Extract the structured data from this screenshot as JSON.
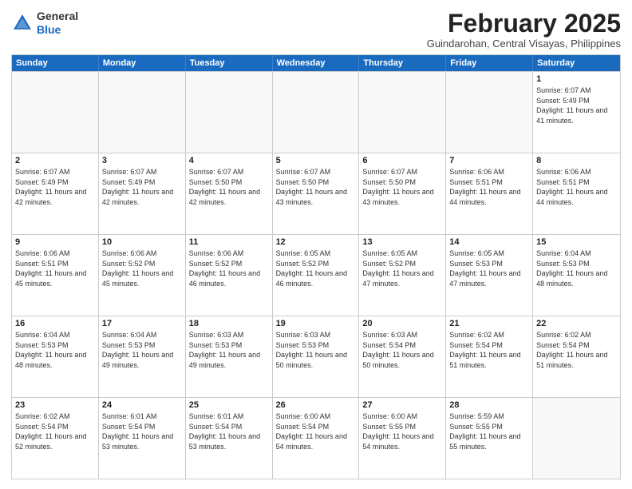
{
  "header": {
    "logo_general": "General",
    "logo_blue": "Blue",
    "month_year": "February 2025",
    "location": "Guindarohan, Central Visayas, Philippines"
  },
  "days_of_week": [
    "Sunday",
    "Monday",
    "Tuesday",
    "Wednesday",
    "Thursday",
    "Friday",
    "Saturday"
  ],
  "weeks": [
    [
      {
        "day": "",
        "empty": true
      },
      {
        "day": "",
        "empty": true
      },
      {
        "day": "",
        "empty": true
      },
      {
        "day": "",
        "empty": true
      },
      {
        "day": "",
        "empty": true
      },
      {
        "day": "",
        "empty": true
      },
      {
        "day": "1",
        "sunrise": "6:07 AM",
        "sunset": "5:49 PM",
        "daylight": "11 hours and 41 minutes."
      }
    ],
    [
      {
        "day": "2",
        "sunrise": "6:07 AM",
        "sunset": "5:49 PM",
        "daylight": "11 hours and 42 minutes."
      },
      {
        "day": "3",
        "sunrise": "6:07 AM",
        "sunset": "5:49 PM",
        "daylight": "11 hours and 42 minutes."
      },
      {
        "day": "4",
        "sunrise": "6:07 AM",
        "sunset": "5:50 PM",
        "daylight": "11 hours and 42 minutes."
      },
      {
        "day": "5",
        "sunrise": "6:07 AM",
        "sunset": "5:50 PM",
        "daylight": "11 hours and 43 minutes."
      },
      {
        "day": "6",
        "sunrise": "6:07 AM",
        "sunset": "5:50 PM",
        "daylight": "11 hours and 43 minutes."
      },
      {
        "day": "7",
        "sunrise": "6:06 AM",
        "sunset": "5:51 PM",
        "daylight": "11 hours and 44 minutes."
      },
      {
        "day": "8",
        "sunrise": "6:06 AM",
        "sunset": "5:51 PM",
        "daylight": "11 hours and 44 minutes."
      }
    ],
    [
      {
        "day": "9",
        "sunrise": "6:06 AM",
        "sunset": "5:51 PM",
        "daylight": "11 hours and 45 minutes."
      },
      {
        "day": "10",
        "sunrise": "6:06 AM",
        "sunset": "5:52 PM",
        "daylight": "11 hours and 45 minutes."
      },
      {
        "day": "11",
        "sunrise": "6:06 AM",
        "sunset": "5:52 PM",
        "daylight": "11 hours and 46 minutes."
      },
      {
        "day": "12",
        "sunrise": "6:05 AM",
        "sunset": "5:52 PM",
        "daylight": "11 hours and 46 minutes."
      },
      {
        "day": "13",
        "sunrise": "6:05 AM",
        "sunset": "5:52 PM",
        "daylight": "11 hours and 47 minutes."
      },
      {
        "day": "14",
        "sunrise": "6:05 AM",
        "sunset": "5:53 PM",
        "daylight": "11 hours and 47 minutes."
      },
      {
        "day": "15",
        "sunrise": "6:04 AM",
        "sunset": "5:53 PM",
        "daylight": "11 hours and 48 minutes."
      }
    ],
    [
      {
        "day": "16",
        "sunrise": "6:04 AM",
        "sunset": "5:53 PM",
        "daylight": "11 hours and 48 minutes."
      },
      {
        "day": "17",
        "sunrise": "6:04 AM",
        "sunset": "5:53 PM",
        "daylight": "11 hours and 49 minutes."
      },
      {
        "day": "18",
        "sunrise": "6:03 AM",
        "sunset": "5:53 PM",
        "daylight": "11 hours and 49 minutes."
      },
      {
        "day": "19",
        "sunrise": "6:03 AM",
        "sunset": "5:53 PM",
        "daylight": "11 hours and 50 minutes."
      },
      {
        "day": "20",
        "sunrise": "6:03 AM",
        "sunset": "5:54 PM",
        "daylight": "11 hours and 50 minutes."
      },
      {
        "day": "21",
        "sunrise": "6:02 AM",
        "sunset": "5:54 PM",
        "daylight": "11 hours and 51 minutes."
      },
      {
        "day": "22",
        "sunrise": "6:02 AM",
        "sunset": "5:54 PM",
        "daylight": "11 hours and 51 minutes."
      }
    ],
    [
      {
        "day": "23",
        "sunrise": "6:02 AM",
        "sunset": "5:54 PM",
        "daylight": "11 hours and 52 minutes."
      },
      {
        "day": "24",
        "sunrise": "6:01 AM",
        "sunset": "5:54 PM",
        "daylight": "11 hours and 53 minutes."
      },
      {
        "day": "25",
        "sunrise": "6:01 AM",
        "sunset": "5:54 PM",
        "daylight": "11 hours and 53 minutes."
      },
      {
        "day": "26",
        "sunrise": "6:00 AM",
        "sunset": "5:54 PM",
        "daylight": "11 hours and 54 minutes."
      },
      {
        "day": "27",
        "sunrise": "6:00 AM",
        "sunset": "5:55 PM",
        "daylight": "11 hours and 54 minutes."
      },
      {
        "day": "28",
        "sunrise": "5:59 AM",
        "sunset": "5:55 PM",
        "daylight": "11 hours and 55 minutes."
      },
      {
        "day": "",
        "empty": true
      }
    ]
  ]
}
